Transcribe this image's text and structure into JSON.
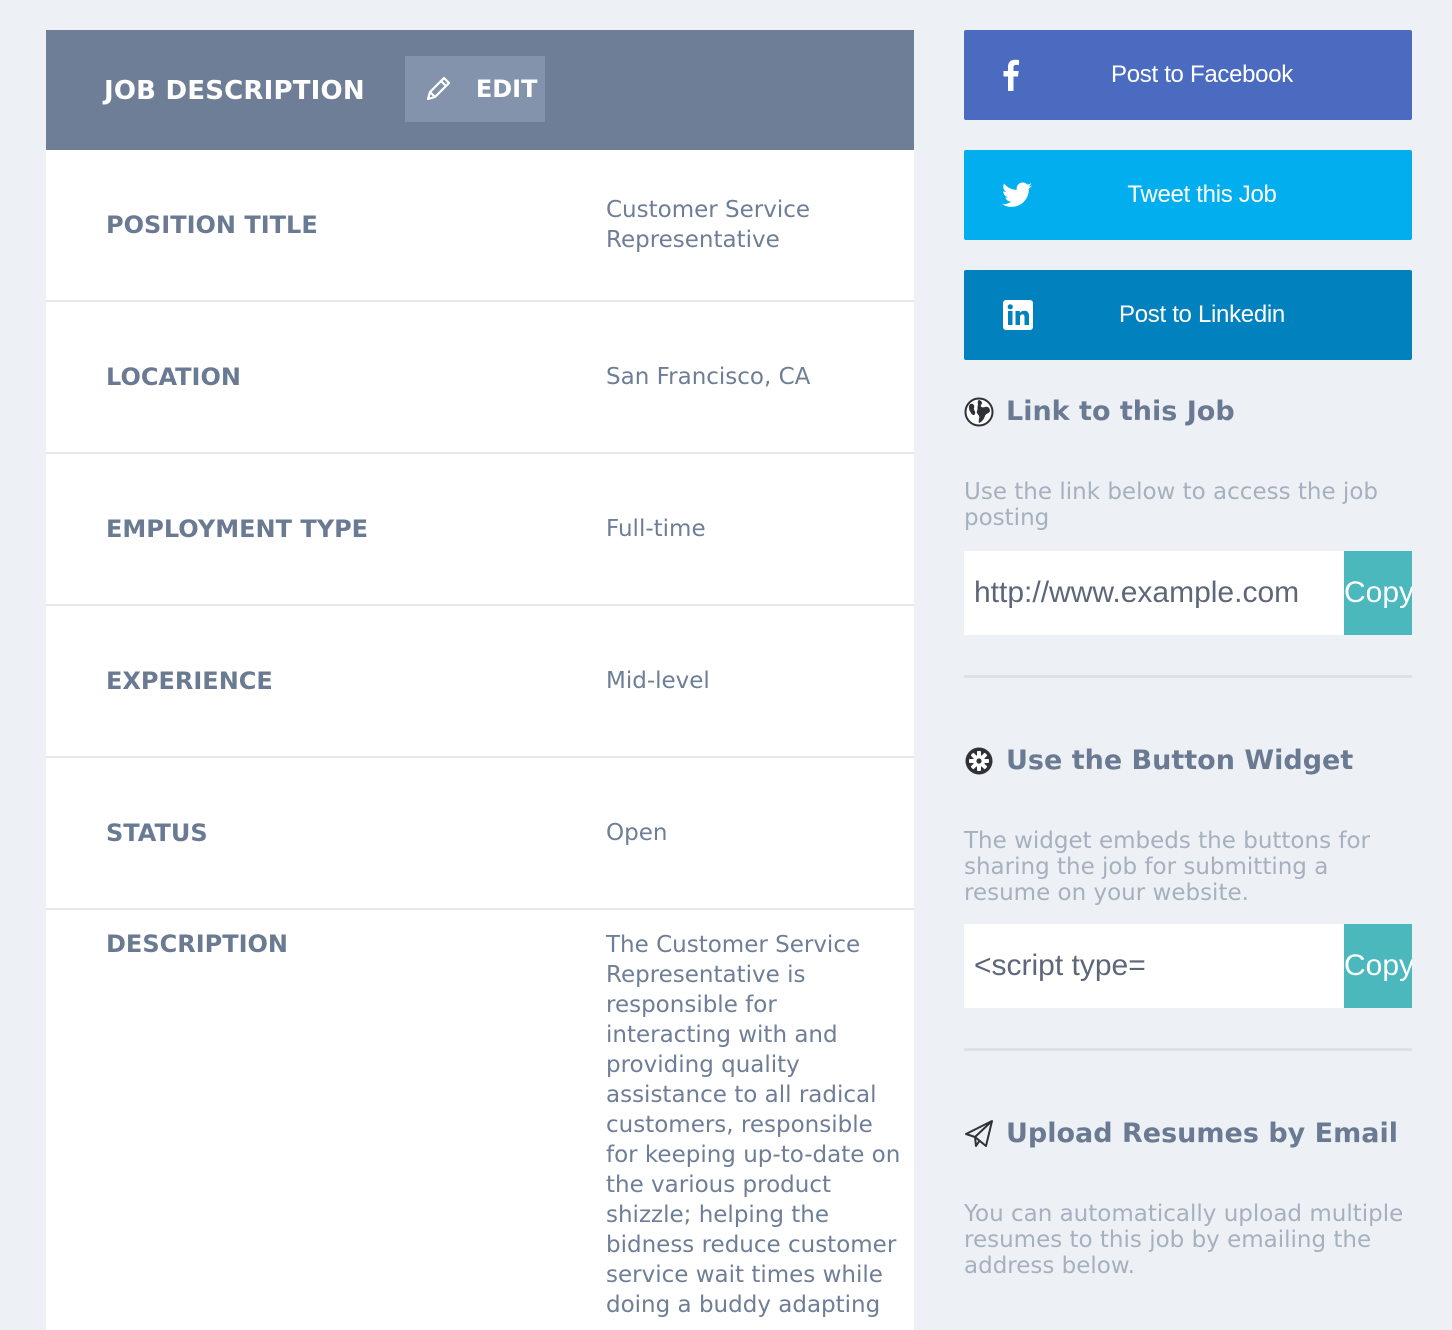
{
  "job_card": {
    "title": "JOB DESCRIPTION",
    "edit_label": "EDIT",
    "fields": [
      {
        "label": "POSITION TITLE",
        "value": "Customer Service Representative"
      },
      {
        "label": "LOCATION",
        "value": "San Francisco, CA"
      },
      {
        "label": "EMPLOYMENT TYPE",
        "value": "Full-time"
      },
      {
        "label": "EXPERIENCE",
        "value": "Mid-level"
      },
      {
        "label": "STATUS",
        "value": "Open"
      }
    ],
    "description": {
      "label": "DESCRIPTION",
      "value": "The Customer Service Representative is responsible for interacting with and providing quality assistance to all radical customers, responsible for keeping up-to-date on the various product shizzle; helping the bidness reduce customer service wait times while doing a buddy adapting"
    }
  },
  "share": {
    "facebook_label": "Post to Facebook",
    "twitter_label": "Tweet this Job",
    "linkedin_label": "Post to Linkedin",
    "colors": {
      "facebook": "#4b6bc0",
      "twitter": "#02aeee",
      "linkedin": "#0181bd",
      "copy": "#4ab8bd"
    }
  },
  "link_section": {
    "heading": "Link to this Job",
    "icon": "globe-icon",
    "text": "Use the link below to access the job posting",
    "url_value": "http://www.example.com",
    "copy_label": "Copy"
  },
  "widget_section": {
    "heading": "Use the Button Widget",
    "icon": "gear-icon",
    "text": "The widget embeds the buttons for sharing the job for submitting a resume on your website.",
    "code_value": "<script type=",
    "copy_label": "Copy"
  },
  "email_section": {
    "heading": "Upload Resumes by Email",
    "icon": "paper-plane-icon",
    "text": "You can automatically upload multiple resumes to this job by emailing the address below."
  }
}
